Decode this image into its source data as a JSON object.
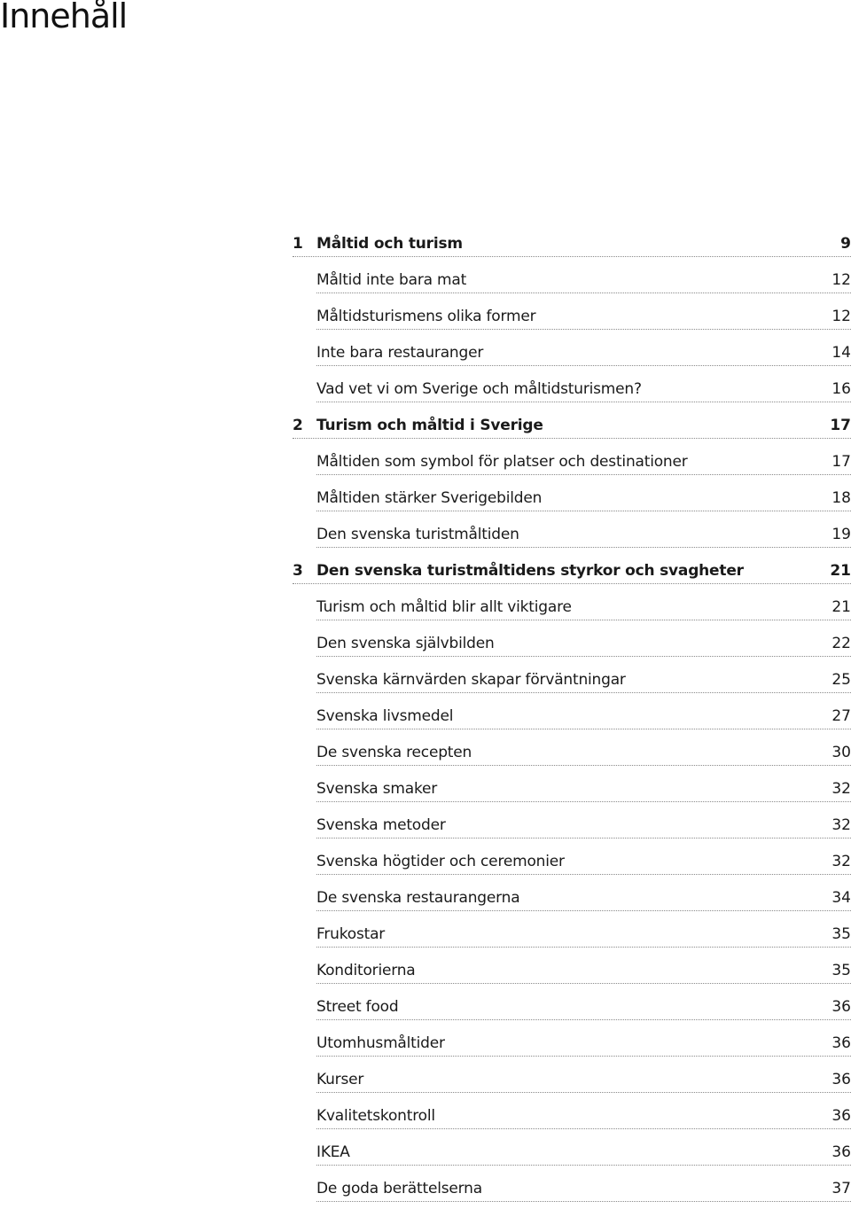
{
  "title": "Innehåll",
  "toc": [
    {
      "type": "chapter",
      "number": "1",
      "label": "Måltid och turism",
      "page": "9"
    },
    {
      "type": "section",
      "label": "Måltid inte bara mat",
      "page": "12"
    },
    {
      "type": "section",
      "label": "Måltidsturismens olika former",
      "page": "12"
    },
    {
      "type": "section",
      "label": "Inte bara restauranger",
      "page": "14"
    },
    {
      "type": "section",
      "label": "Vad vet vi om Sverige och måltidsturismen?",
      "page": "16"
    },
    {
      "type": "chapter",
      "number": "2",
      "label": "Turism och måltid i Sverige",
      "page": "17"
    },
    {
      "type": "section",
      "label": "Måltiden som symbol för platser och destinationer",
      "page": "17"
    },
    {
      "type": "section",
      "label": "Måltiden stärker Sverigebilden",
      "page": "18"
    },
    {
      "type": "section",
      "label": "Den svenska turistmåltiden",
      "page": "19"
    },
    {
      "type": "chapter",
      "number": "3",
      "label": "Den svenska turistmåltidens styrkor och svagheter",
      "page": "21"
    },
    {
      "type": "section",
      "label": "Turism och måltid blir allt viktigare",
      "page": "21"
    },
    {
      "type": "section",
      "label": "Den svenska självbilden",
      "page": "22"
    },
    {
      "type": "section",
      "label": "Svenska kärnvärden skapar förväntningar",
      "page": "25"
    },
    {
      "type": "section",
      "label": "Svenska livsmedel",
      "page": "27"
    },
    {
      "type": "section",
      "label": "De svenska recepten",
      "page": "30"
    },
    {
      "type": "section",
      "label": "Svenska smaker",
      "page": "32"
    },
    {
      "type": "section",
      "label": "Svenska metoder",
      "page": "32"
    },
    {
      "type": "section",
      "label": "Svenska högtider och ceremonier",
      "page": "32"
    },
    {
      "type": "section",
      "label": "De svenska restaurangerna",
      "page": "34"
    },
    {
      "type": "section",
      "label": "Frukostar",
      "page": "35"
    },
    {
      "type": "section",
      "label": "Konditorierna",
      "page": "35"
    },
    {
      "type": "section",
      "label": "Street food",
      "page": "36"
    },
    {
      "type": "section",
      "label": "Utomhusmåltider",
      "page": "36"
    },
    {
      "type": "section",
      "label": "Kurser",
      "page": "36"
    },
    {
      "type": "section",
      "label": "Kvalitetskontroll",
      "page": "36"
    },
    {
      "type": "section",
      "label": "IKEA",
      "page": "36"
    },
    {
      "type": "section",
      "label": "De goda berättelserna",
      "page": "37"
    }
  ]
}
